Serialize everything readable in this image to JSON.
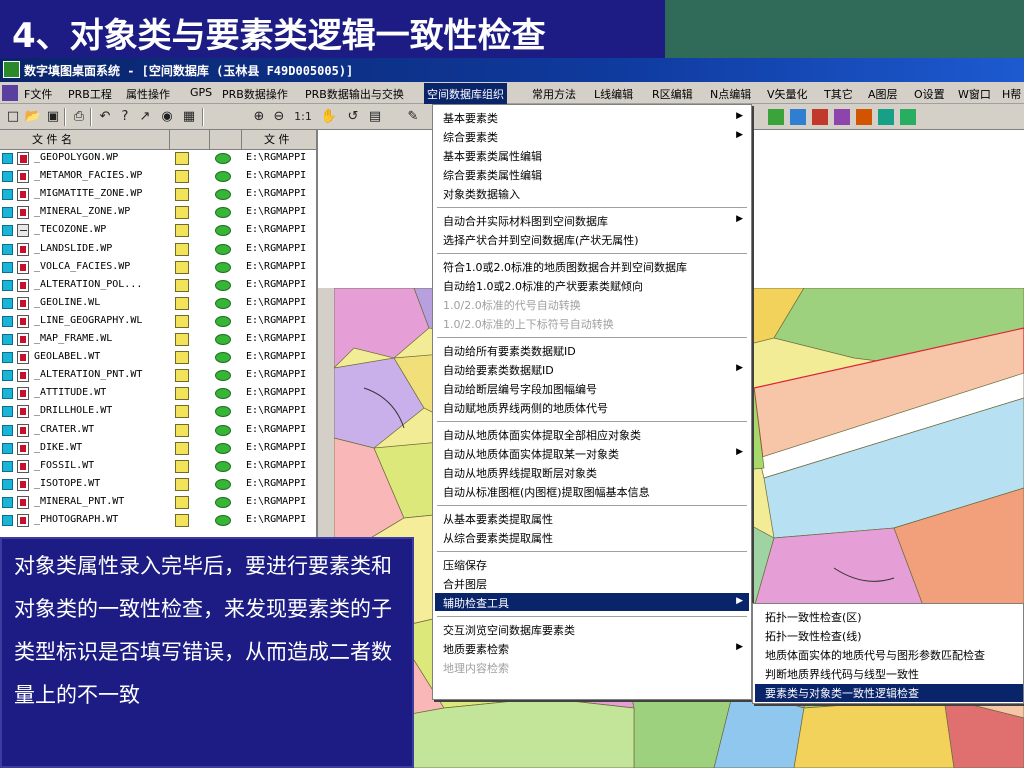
{
  "slide": {
    "title": "4、对象类与要素类逻辑一致性检查",
    "note": "对象类属性录入完毕后，要进行要素类和对象类的一致性检查，来发现要素类的子类型标识是否填写错误，从而造成二者数量上的不一致"
  },
  "window": {
    "title": "数字填图桌面系统 - [空间数据库   (玉林县   F49D005005)]"
  },
  "menubar": [
    {
      "label": "F文件"
    },
    {
      "label": "PRB工程"
    },
    {
      "label": "属性操作"
    },
    {
      "label": "GPS"
    },
    {
      "label": "PRB数据操作"
    },
    {
      "label": "PRB数据输出与交换"
    },
    {
      "label": "空间数据库组织"
    },
    {
      "label": "常用方法"
    },
    {
      "label": "L线编辑"
    },
    {
      "label": "R区编辑"
    },
    {
      "label": "N点编辑"
    },
    {
      "label": "V矢量化"
    },
    {
      "label": "T其它"
    },
    {
      "label": "A图层"
    },
    {
      "label": "O设置"
    },
    {
      "label": "W窗口"
    },
    {
      "label": "H帮"
    }
  ],
  "toolbar": {
    "zoom_label": "1:1"
  },
  "file_panel": {
    "headers": {
      "name": "文 件 名",
      "path": "文 件"
    },
    "rows": [
      {
        "name": "_GEOPOLYGON.WP",
        "path": "E:\\RGMAPPI",
        "type": "geo"
      },
      {
        "name": "_METAMOR_FACIES.WP",
        "path": "E:\\RGMAPPI",
        "type": "poly"
      },
      {
        "name": "_MIGMATITE_ZONE.WP",
        "path": "E:\\RGMAPPI",
        "type": "poly"
      },
      {
        "name": "_MINERAL_ZONE.WP",
        "path": "E:\\RGMAPPI",
        "type": "poly"
      },
      {
        "name": "_TECOZONE.WP",
        "path": "E:\\RGMAPPI",
        "type": "line"
      },
      {
        "name": "_LANDSLIDE.WP",
        "path": "E:\\RGMAPPI",
        "type": "poly"
      },
      {
        "name": "_VOLCA_FACIES.WP",
        "path": "E:\\RGMAPPI",
        "type": "poly"
      },
      {
        "name": "_ALTERATION_POL...",
        "path": "E:\\RGMAPPI",
        "type": "poly"
      },
      {
        "name": "_GEOLINE.WL",
        "path": "E:\\RGMAPPI",
        "type": "poly"
      },
      {
        "name": "_LINE_GEOGRAPHY.WL",
        "path": "E:\\RGMAPPI",
        "type": "poly"
      },
      {
        "name": "_MAP_FRAME.WL",
        "path": "E:\\RGMAPPI",
        "type": "poly"
      },
      {
        "name": "GEOLABEL.WT",
        "path": "E:\\RGMAPPI",
        "type": "poly"
      },
      {
        "name": "_ALTERATION_PNT.WT",
        "path": "E:\\RGMAPPI",
        "type": "poly"
      },
      {
        "name": "_ATTITUDE.WT",
        "path": "E:\\RGMAPPI",
        "type": "poly"
      },
      {
        "name": "_DRILLHOLE.WT",
        "path": "E:\\RGMAPPI",
        "type": "poly"
      },
      {
        "name": "_CRATER.WT",
        "path": "E:\\RGMAPPI",
        "type": "poly"
      },
      {
        "name": "_DIKE.WT",
        "path": "E:\\RGMAPPI",
        "type": "poly"
      },
      {
        "name": "_FOSSIL.WT",
        "path": "E:\\RGMAPPI",
        "type": "poly"
      },
      {
        "name": "_ISOTOPE.WT",
        "path": "E:\\RGMAPPI",
        "type": "poly"
      },
      {
        "name": "_MINERAL_PNT.WT",
        "path": "E:\\RGMAPPI",
        "type": "poly"
      },
      {
        "name": "_PHOTOGRAPH.WT",
        "path": "E:\\RGMAPPI",
        "type": "poly"
      }
    ]
  },
  "popup_menu": {
    "groups": [
      [
        {
          "label": "基本要素类",
          "submenu": true
        },
        {
          "label": "综合要素类",
          "submenu": true
        },
        {
          "label": "基本要素类属性编辑"
        },
        {
          "label": "综合要素类属性编辑"
        },
        {
          "label": "对象类数据输入"
        }
      ],
      [
        {
          "label": "自动合并实际材料图到空间数据库",
          "submenu": true
        },
        {
          "label": "选择产状合并到空间数据库(产状无属性)"
        }
      ],
      [
        {
          "label": "符合1.0或2.0标准的地质图数据合并到空间数据库"
        },
        {
          "label": "自动给1.0或2.0标准的产状要素类赋倾向"
        },
        {
          "label": "1.0/2.0标准的代号自动转换",
          "disabled": true
        },
        {
          "label": "1.0/2.0标准的上下标符号自动转换",
          "disabled": true
        }
      ],
      [
        {
          "label": "自动给所有要素类数据赋ID"
        },
        {
          "label": "自动给要素类数据赋ID",
          "submenu": true
        },
        {
          "label": "自动给断层编号字段加图幅编号"
        },
        {
          "label": "自动赋地质界线两侧的地质体代号"
        }
      ],
      [
        {
          "label": "自动从地质体面实体提取全部相应对象类"
        },
        {
          "label": "自动从地质体面实体提取某一对象类",
          "submenu": true
        },
        {
          "label": "自动从地质界线提取断层对象类"
        },
        {
          "label": "自动从标准图框(内图框)提取图幅基本信息"
        }
      ],
      [
        {
          "label": "从基本要素类提取属性"
        },
        {
          "label": "从综合要素类提取属性"
        }
      ],
      [
        {
          "label": "压缩保存"
        },
        {
          "label": "合并图层"
        },
        {
          "label": "辅助检查工具",
          "submenu": true,
          "highlighted": true
        }
      ],
      [
        {
          "label": "交互浏览空间数据库要素类"
        },
        {
          "label": "地质要素检索",
          "submenu": true
        },
        {
          "label": "地理内容检索",
          "disabled": true
        }
      ]
    ]
  },
  "submenu": {
    "items": [
      {
        "label": "拓扑一致性检查(区)"
      },
      {
        "label": "拓扑一致性检查(线)"
      },
      {
        "label": "地质体面实体的地质代号与图形参数匹配检查"
      },
      {
        "label": "判断地质界线代码与线型一致性"
      },
      {
        "label": "要素类与对象类一致性逻辑检查",
        "highlighted": true
      }
    ]
  },
  "colors": {
    "slide_bg": "#1c1c84",
    "title_accent": "#2f6b58",
    "highlight": "#0a246a",
    "map_base": "#f3ec96"
  }
}
